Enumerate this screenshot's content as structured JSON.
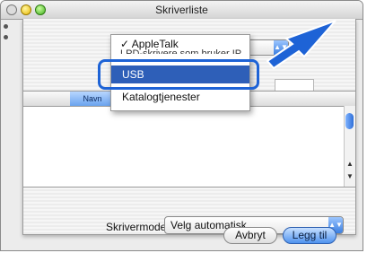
{
  "window": {
    "title": "Skriverliste"
  },
  "menu": {
    "checked_item": "✓ AppleTalk",
    "partial_item": "LPD-skrivere som bruker IP",
    "selected_item": "USB",
    "item_katalog": "Katalogtjenester"
  },
  "list": {
    "column_name": "Navn"
  },
  "form": {
    "printer_model_label": "Skrivermodell:",
    "printer_model_value": "Velg automatisk..."
  },
  "buttons": {
    "cancel": "Avbryt",
    "add": "Legg til"
  },
  "colors": {
    "highlight": "#2e5fb8",
    "callout": "#1e63d6"
  }
}
